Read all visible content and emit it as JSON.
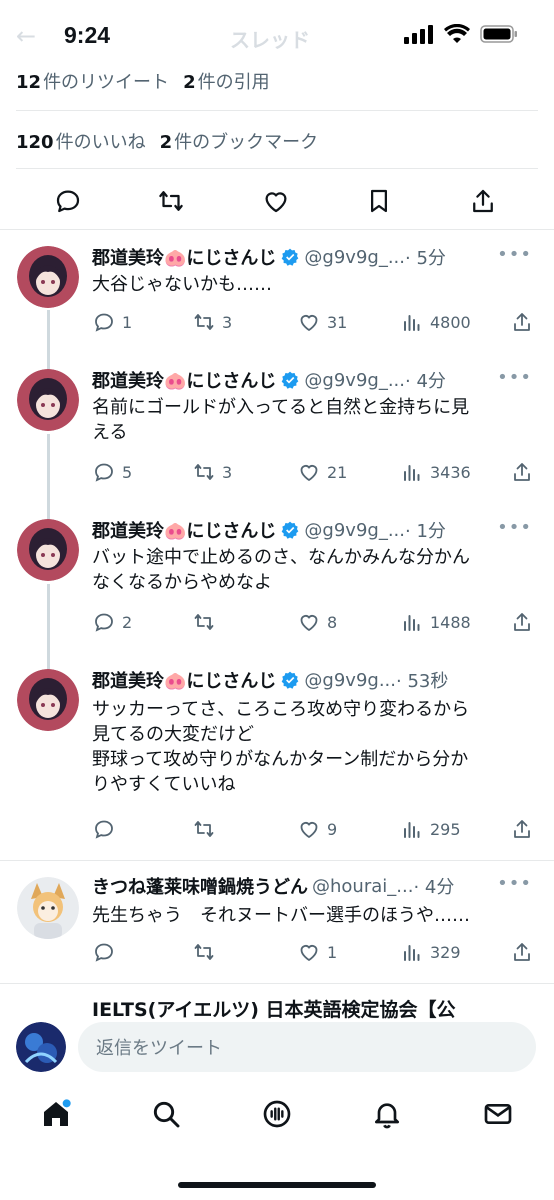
{
  "status_bar": {
    "time": "9:24"
  },
  "header": {
    "faded_title": "スレッド"
  },
  "stats": {
    "retweets_count": "12",
    "retweets_label": "件のリツイート",
    "quotes_count": "2",
    "quotes_label": "件の引用",
    "likes_count": "120",
    "likes_label": "件のいいね",
    "bookmarks_count": "2",
    "bookmarks_label": "件のブックマーク"
  },
  "tweets": [
    {
      "name": "郡道美玲🐽にじさんじ",
      "handle": "@g9v9g_...",
      "time": "· 5分",
      "body": "大谷じゃないかも……",
      "replies": "1",
      "retweets": "3",
      "likes": "31",
      "views": "4800"
    },
    {
      "name": "郡道美玲🐽にじさんじ",
      "handle": "@g9v9g_...",
      "time": "· 4分",
      "body": "名前にゴールドが入ってると自然と金持ちに見\nえる",
      "replies": "5",
      "retweets": "3",
      "likes": "21",
      "views": "3436"
    },
    {
      "name": "郡道美玲🐽にじさんじ",
      "handle": "@g9v9g_...",
      "time": "· 1分",
      "body": "バット途中で止めるのさ、なんかみんな分かん\nなくなるからやめなよ",
      "replies": "2",
      "retweets": "",
      "likes": "8",
      "views": "1488"
    },
    {
      "name": "郡道美玲🐽にじさんじ",
      "handle": "@g9v9g...",
      "time": "· 53秒",
      "body": "サッカーってさ、ころころ攻め守り変わるから\n見てるの大変だけど\n野球って攻め守りがなんかターン制だから分か\nりやすくていいね",
      "replies": "",
      "retweets": "",
      "likes": "9",
      "views": "295"
    },
    {
      "name": "きつね蓬莱味噌鍋焼うどん",
      "handle": "@hourai_...",
      "time": "· 4分",
      "body": "先生ちゃう　それヌートバー選手のほうや……",
      "replies": "",
      "retweets": "",
      "likes": "1",
      "views": "329"
    }
  ],
  "peek_name": "IELTS(アイエルツ) 日本英語検定協会【公",
  "reply_bar": {
    "placeholder": "返信をツイート"
  },
  "colors": {
    "blue": "#1d9bf0",
    "text": "#0f1419",
    "muted": "#536471"
  }
}
